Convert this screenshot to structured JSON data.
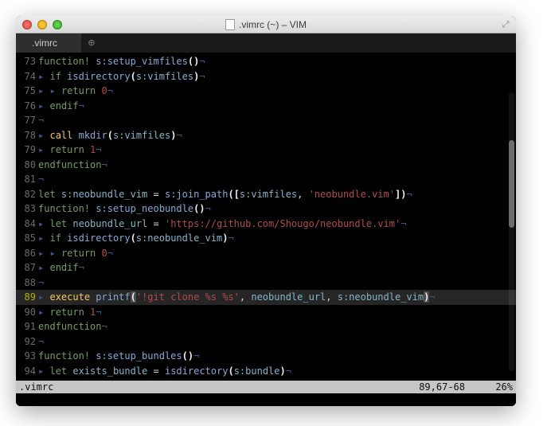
{
  "window": {
    "title": ".vimrc (~) – VIM"
  },
  "tabs": {
    "active_label": ".vimrc"
  },
  "gutter": {
    "start": 73,
    "current": 89
  },
  "code": {
    "l73": {
      "kw": "function!",
      "id": " s:setup_vimfiles",
      "p": "()"
    },
    "l74": {
      "kw": "if",
      "fn": " isdirectory",
      "p1": "(",
      "v": "s:vimfiles",
      "p2": ")"
    },
    "l75": {
      "kw": "return ",
      "n": "0"
    },
    "l76": {
      "kw": "endif"
    },
    "l78": {
      "ex": "call",
      "fn": " mkdir",
      "p1": "(",
      "v": "s:vimfiles",
      "p2": ")"
    },
    "l79": {
      "kw": "return ",
      "n": "1"
    },
    "l80": {
      "kw": "endfunction"
    },
    "l82": {
      "kw": "let ",
      "v1": "s:neobundle_vim",
      "eq": " = ",
      "fn": "s:join_path",
      "p1": "([",
      "v2": "s:vimfiles",
      "c": ", ",
      "s": "'neobundle.vim'",
      "p2": "])"
    },
    "l83": {
      "kw": "function!",
      "id": " s:setup_neobundle",
      "p": "()"
    },
    "l84": {
      "kw": "let ",
      "v": "neobundle_url",
      "eq": " = ",
      "s": "'https://github.com/Shougo/neobundle.vim'"
    },
    "l85": {
      "kw": "if",
      "fn": " isdirectory",
      "p1": "(",
      "v": "s:neobundle_vim",
      "p2": ")"
    },
    "l86": {
      "kw": "return ",
      "n": "0"
    },
    "l87": {
      "kw": "endif"
    },
    "l89": {
      "ex": "execute",
      "fn": " printf",
      "p1": "(",
      "s": "'!git clone %s %s'",
      "c1": ", ",
      "v1": "neobundle_url",
      "c2": ", ",
      "v2": "s:neobundle_vim",
      "p2": ")"
    },
    "l90": {
      "kw": "return ",
      "n": "1"
    },
    "l91": {
      "kw": "endfunction"
    },
    "l93": {
      "kw": "function!",
      "id": " s:setup_bundles",
      "p": "()"
    },
    "l94": {
      "kw": "let ",
      "v1": "exists_bundle",
      "eq": " = ",
      "fn": "isdirectory",
      "p1": "(",
      "v2": "s:bundle",
      "p2": ")"
    }
  },
  "listchars": {
    "tab_first": "▸",
    "tab_rest": " ",
    "eol": "¬"
  },
  "status": {
    "file": ".vimrc",
    "pos": "89,67-68",
    "pct": "26%"
  }
}
